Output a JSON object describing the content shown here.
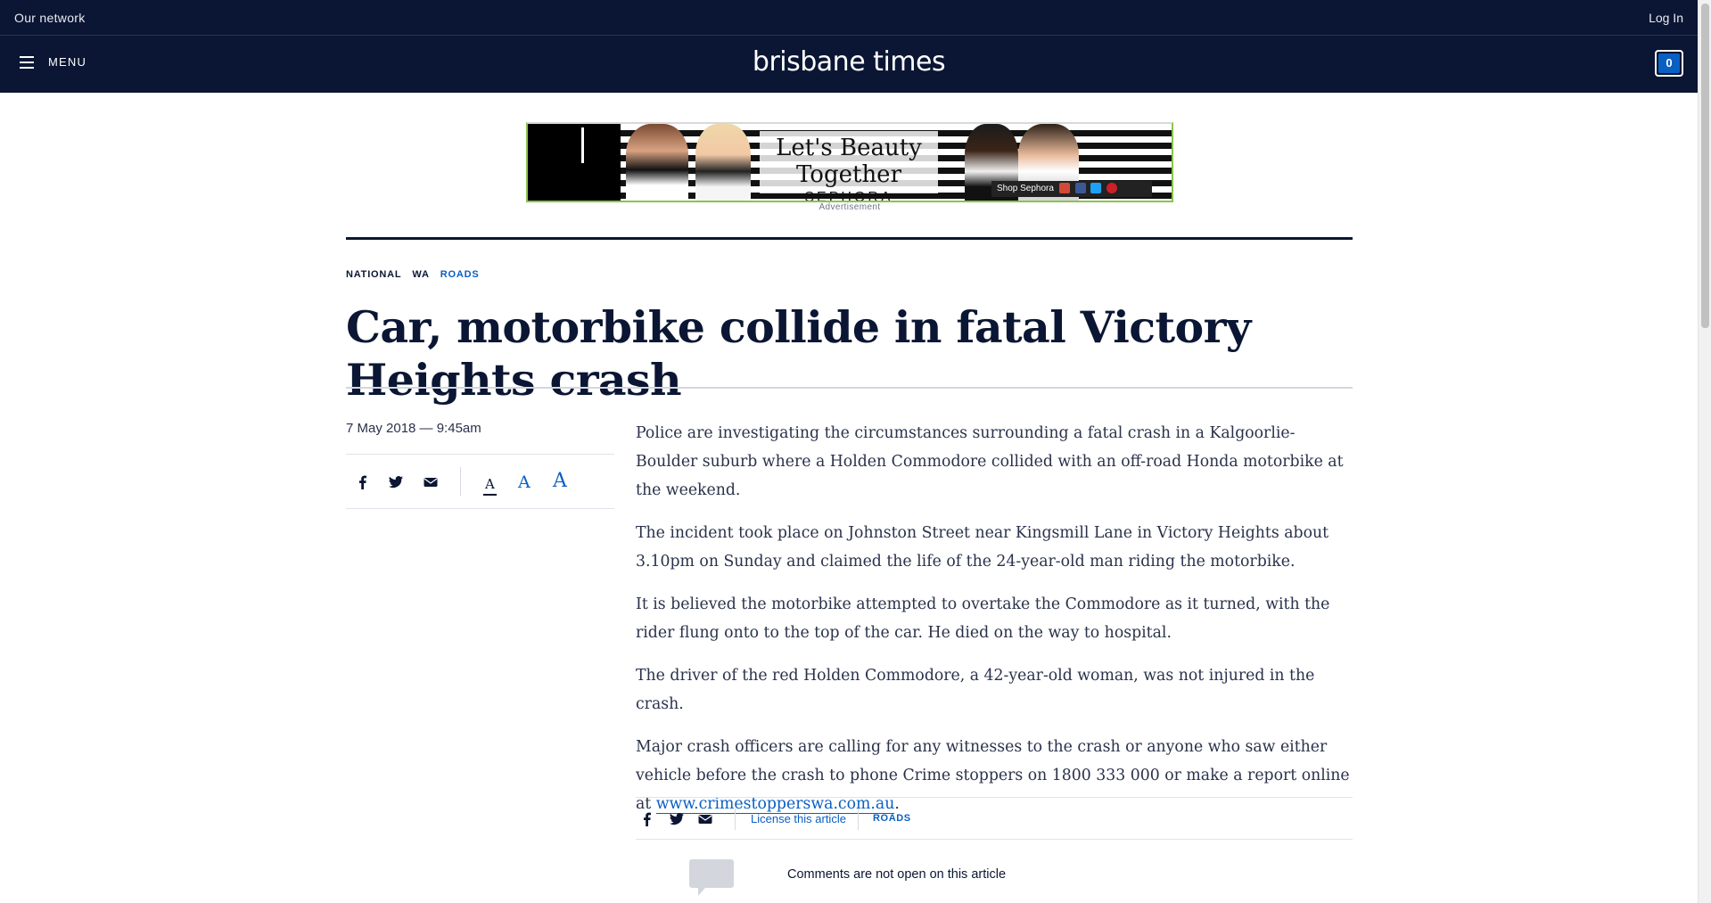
{
  "network_bar": {
    "left_label": "Our network",
    "right_label": "Log In"
  },
  "masthead": {
    "menu_label": "MENU",
    "logo_text": "brisbane times",
    "cart_count": "0"
  },
  "advertisement": {
    "headline": "Let's Beauty Together",
    "brand": "SEPHORA",
    "cta": "Shop Sephora",
    "label": "Advertisement"
  },
  "article": {
    "breadcrumbs": [
      "NATIONAL",
      "WA",
      "ROADS"
    ],
    "headline": "Car, motorbike collide in fatal Victory Heights crash",
    "dateline": "7 May 2018 — 9:45am",
    "font_size_options": [
      "A",
      "A",
      "A"
    ],
    "paragraphs": [
      "Police are investigating the circumstances surrounding a fatal crash in a Kalgoorlie-Boulder suburb where a Holden Commodore collided with an off-road Honda motorbike at the weekend.",
      "The incident took place on Johnston Street near Kingsmill Lane in Victory Heights about 3.10pm on Sunday and claimed the life of the 24-year-old man riding the motorbike.",
      "It is believed the motorbike attempted to overtake the Commodore as it turned, with the rider flung onto to the top of the car. He died on the way to hospital.",
      "The driver of the red Holden Commodore, a 42-year-old woman, was not injured in the crash.",
      "Major crash officers are calling for any witnesses to the crash or anyone who saw either vehicle before the crash to phone Crime stoppers on 1800 333 000 or make a report online at"
    ],
    "link_text": "www.crimestopperswa.com.au",
    "link_trailing": "."
  },
  "footer": {
    "license_label": "License this article",
    "topic_tag": "ROADS",
    "comments_note": "Comments are not open on this article"
  },
  "icons": {
    "facebook": "facebook-icon",
    "twitter": "twitter-icon",
    "email": "email-icon",
    "comment": "speech-bubble-icon",
    "menu": "hamburger-icon"
  },
  "colors": {
    "brand_navy": "#0a1633",
    "accent_blue": "#0a5fc2",
    "ad_border": "#8bc34a"
  }
}
